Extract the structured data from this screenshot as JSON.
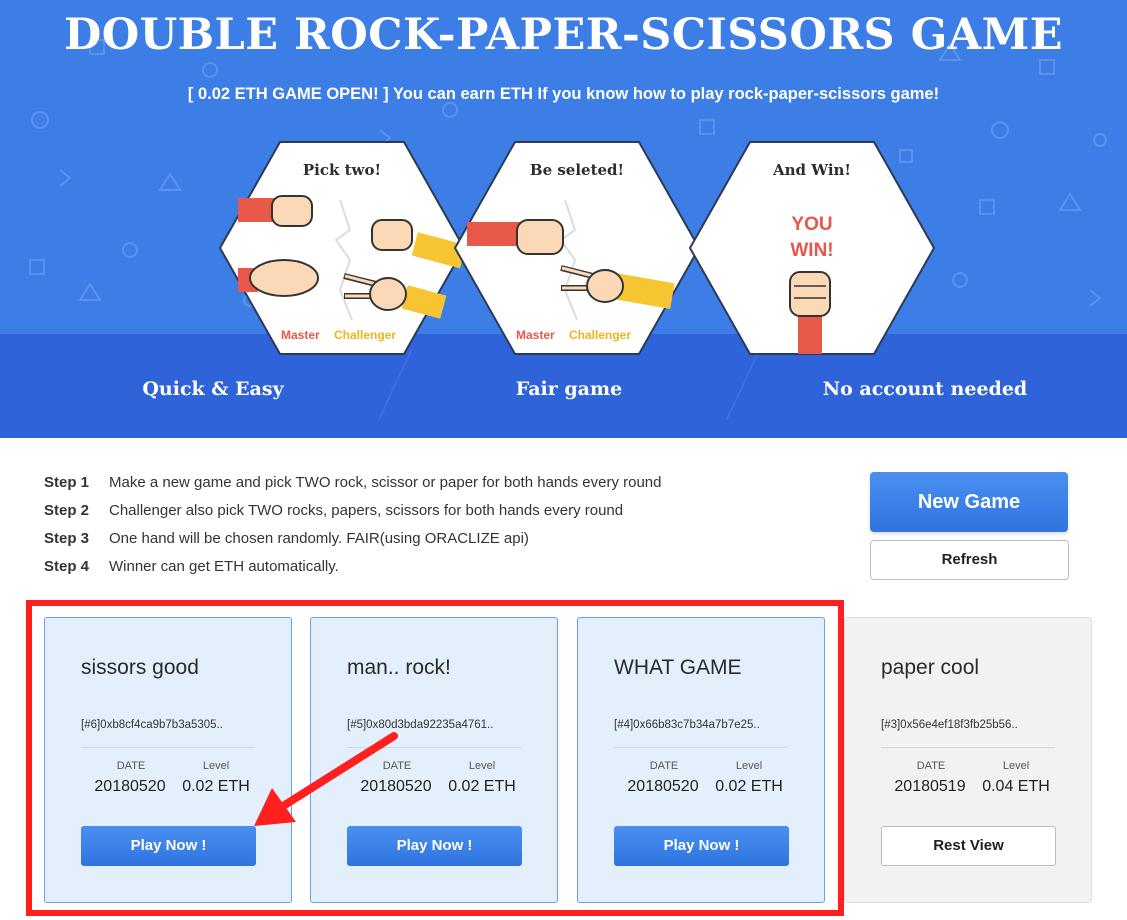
{
  "hero": {
    "title": "DOUBLE ROCK-PAPER-SCISSORS GAME",
    "subtitle": "[ 0.02 ETH GAME OPEN! ] You can earn ETH If you know how to play rock-paper-scissors game!",
    "panels": [
      {
        "title": "Pick two!",
        "master_label": "Master",
        "challenger_label": "Challenger"
      },
      {
        "title": "Be seleted!",
        "master_label": "Master",
        "challenger_label": "Challenger"
      },
      {
        "title": "And Win!",
        "win_line1": "YOU",
        "win_line2": "WIN!"
      }
    ],
    "features": [
      "Quick & Easy",
      "Fair game",
      "No account needed"
    ]
  },
  "steps": [
    {
      "label": "Step 1",
      "text": "Make a new game and pick TWO rock, scissor or paper for both hands every round"
    },
    {
      "label": "Step 2",
      "text": "Challenger also pick TWO rocks, papers, scissors for both hands every round"
    },
    {
      "label": "Step 3",
      "text": "One hand will be chosen randomly. FAIR(using ORACLIZE api)"
    },
    {
      "label": "Step 4",
      "text": "Winner can get ETH automatically."
    }
  ],
  "actions": {
    "new_game": "New Game",
    "refresh": "Refresh"
  },
  "games": [
    {
      "title": "sissors good",
      "address": "[#6]0xb8cf4ca9b7b3a5305..",
      "date_label": "DATE",
      "level_label": "Level",
      "date": "20180520",
      "level": "0.02 ETH",
      "button": "Play Now !"
    },
    {
      "title": "man.. rock!",
      "address": "[#5]0x80d3bda92235a4761..",
      "date_label": "DATE",
      "level_label": "Level",
      "date": "20180520",
      "level": "0.02 ETH",
      "button": "Play Now !"
    },
    {
      "title": "WHAT GAME",
      "address": "[#4]0x66b83c7b34a7b7e25..",
      "date_label": "DATE",
      "level_label": "Level",
      "date": "20180520",
      "level": "0.02 ETH",
      "button": "Play Now !"
    },
    {
      "title": "paper cool",
      "address": "[#3]0x56e4ef18f3fb25b56..",
      "date_label": "DATE",
      "level_label": "Level",
      "date": "20180519",
      "level": "0.04 ETH",
      "button": "Rest View"
    }
  ],
  "colors": {
    "hero_blue": "#3d7ee6",
    "hero_dark": "#2f63d9",
    "button_blue": "#3a82ec",
    "highlight_red": "#ff1f1f",
    "master_red": "#e8584a",
    "challenger_yellow": "#f7c531"
  }
}
